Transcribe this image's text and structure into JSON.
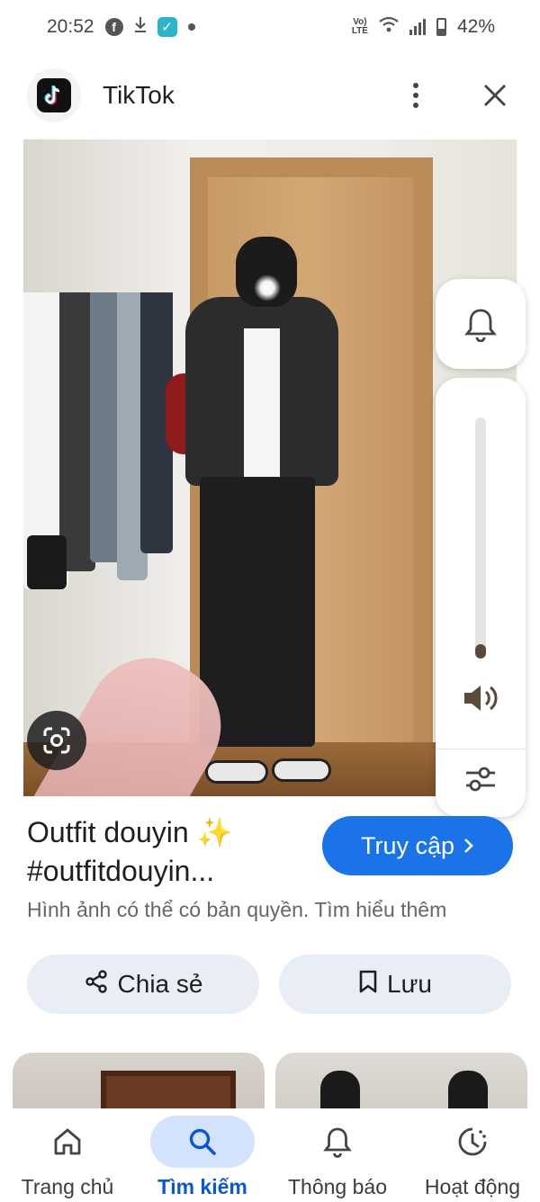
{
  "status_bar": {
    "time": "20:52",
    "battery": "42%",
    "network_label": "VoLTE",
    "icons": [
      "facebook-icon",
      "download-icon",
      "check-app-icon",
      "dot-icon",
      "volte-icon",
      "wifi-icon",
      "signal-icon",
      "battery-icon"
    ]
  },
  "header": {
    "app_name": "TikTok",
    "icons": [
      "tiktok-logo-icon",
      "more-vert-icon",
      "close-icon"
    ]
  },
  "image": {
    "lens_icon": "google-lens-icon"
  },
  "volume_panel": {
    "level": 0.06,
    "icons": [
      "bell-icon",
      "volume-icon",
      "equalizer-icon"
    ],
    "fill_color": "#594a3a"
  },
  "result": {
    "title": "Outfit douyin ✨ #outfitdouyin...",
    "visit_label": "Truy cập",
    "copyright_text": "Hình ảnh có thể có bản quyền. Tìm hiểu thêm",
    "share_label": "Chia sẻ",
    "save_label": "Lưu"
  },
  "bottom_nav": {
    "items": [
      {
        "label": "Trang chủ",
        "icon": "home-icon",
        "active": false
      },
      {
        "label": "Tìm kiếm",
        "icon": "search-icon",
        "active": true
      },
      {
        "label": "Thông báo",
        "icon": "bell-icon",
        "active": false
      },
      {
        "label": "Hoạt động",
        "icon": "history-icon",
        "active": false
      }
    ]
  },
  "colors": {
    "accent": "#1a73e8",
    "active_nav": "#0b57d0",
    "active_pill": "#d3e3fd",
    "secondary_button": "#e9eef6"
  }
}
